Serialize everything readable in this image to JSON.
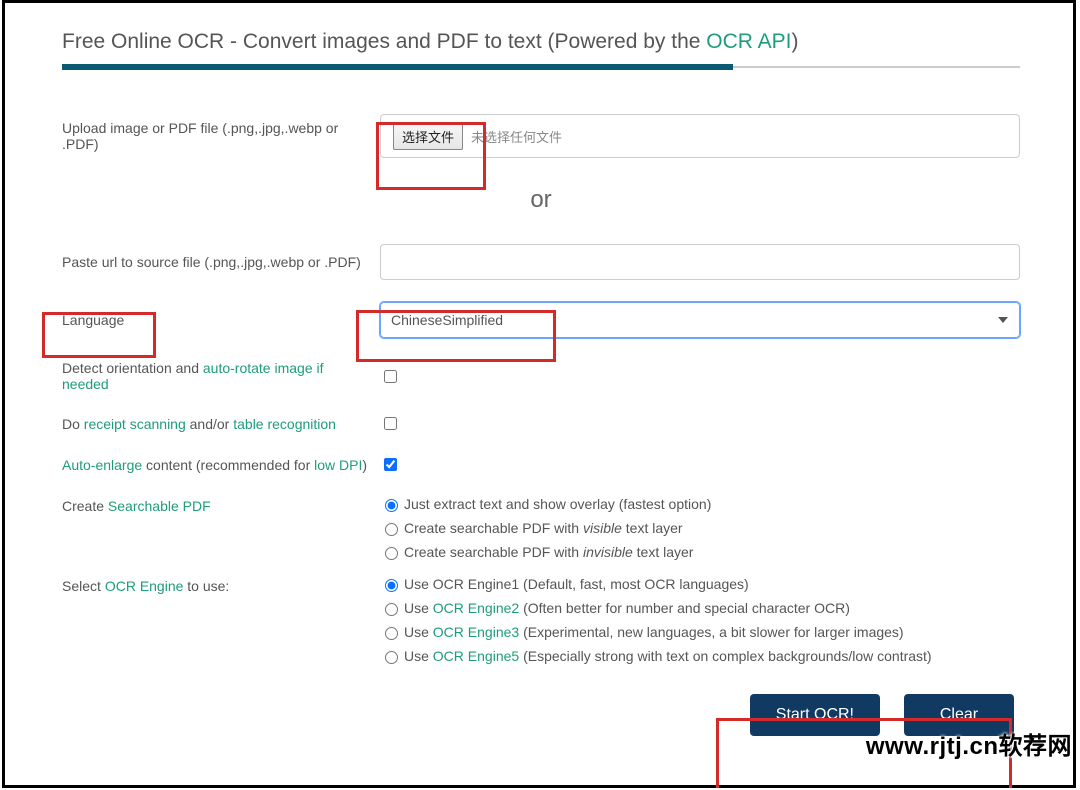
{
  "header": {
    "title_prefix": "Free Online OCR - Convert images and PDF to text (Powered by the ",
    "title_link": "OCR API",
    "title_suffix": ")"
  },
  "upload": {
    "label": "Upload image or PDF file (.png,.jpg,.webp or .PDF)",
    "choose_button": "选择文件",
    "no_file_text": "未选择任何文件"
  },
  "or_label": "or",
  "url_row": {
    "label": "Paste url to source file (.png,.jpg,.webp or .PDF)",
    "value": ""
  },
  "language": {
    "label": "Language",
    "selected": "ChineseSimplified"
  },
  "detect": {
    "prefix": "Detect orientation and ",
    "link": "auto-rotate image if needed",
    "checked": false
  },
  "receipt": {
    "prefix": "Do ",
    "link1": "receipt scanning",
    "mid": " and/or ",
    "link2": "table recognition",
    "checked": false
  },
  "enlarge": {
    "link1": "Auto-enlarge",
    "mid": " content (recommended for ",
    "link2": "low DPI",
    "suffix": ")",
    "checked": true
  },
  "pdf": {
    "label_prefix": "Create ",
    "label_link": "Searchable PDF",
    "options": [
      {
        "text_html": "Just extract text and show overlay (fastest option)",
        "checked": true
      },
      {
        "text_html": "Create searchable PDF with <span class=\"italic\">visible</span> text layer",
        "checked": false
      },
      {
        "text_html": "Create searchable PDF with <span class=\"italic\">invisible</span> text layer",
        "checked": false
      }
    ]
  },
  "engine": {
    "label_prefix": "Select ",
    "label_link": "OCR Engine",
    "label_suffix": " to use:",
    "options": [
      {
        "text_html": "Use OCR Engine1 (Default, fast, most OCR languages)",
        "checked": true
      },
      {
        "text_html": "Use <span class=\"link\">OCR Engine2</span> (Often better for number and special character OCR)",
        "checked": false
      },
      {
        "text_html": "Use <span class=\"link\">OCR Engine3</span> (Experimental, new languages, a bit slower for larger images)",
        "checked": false
      },
      {
        "text_html": "Use <span class=\"link\">OCR Engine5</span> (Especially strong with text on complex backgrounds/low contrast)",
        "checked": false
      }
    ]
  },
  "buttons": {
    "start": "Start OCR!",
    "clear": "Clear"
  },
  "watermark": "www.rjtj.cn软荐网"
}
